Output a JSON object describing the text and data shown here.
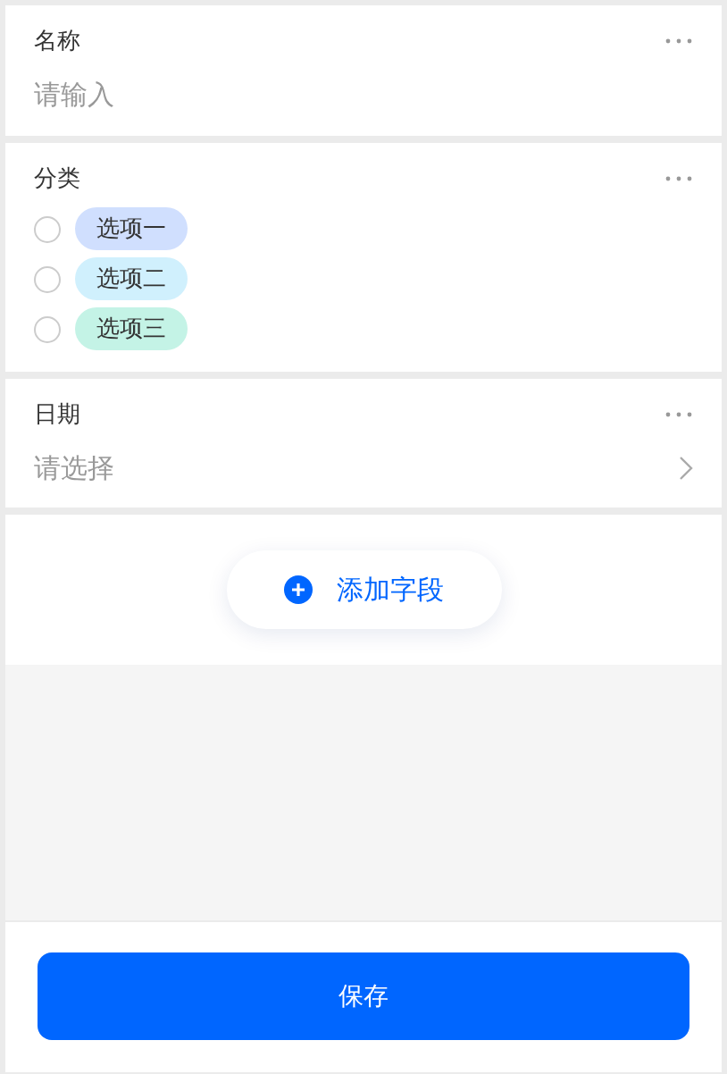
{
  "fields": [
    {
      "kind": "input",
      "label": "名称",
      "placeholder": "请输入"
    },
    {
      "kind": "radio",
      "label": "分类",
      "options": [
        {
          "label": "选项一",
          "selected": false,
          "color": "#d0dffe"
        },
        {
          "label": "选项二",
          "selected": false,
          "color": "#d0f0fd"
        },
        {
          "label": "选项三",
          "selected": false,
          "color": "#c4f3e6"
        }
      ]
    },
    {
      "kind": "select",
      "label": "日期",
      "placeholder": "请选择"
    }
  ],
  "add_button": "添加字段",
  "save_button": "保存"
}
